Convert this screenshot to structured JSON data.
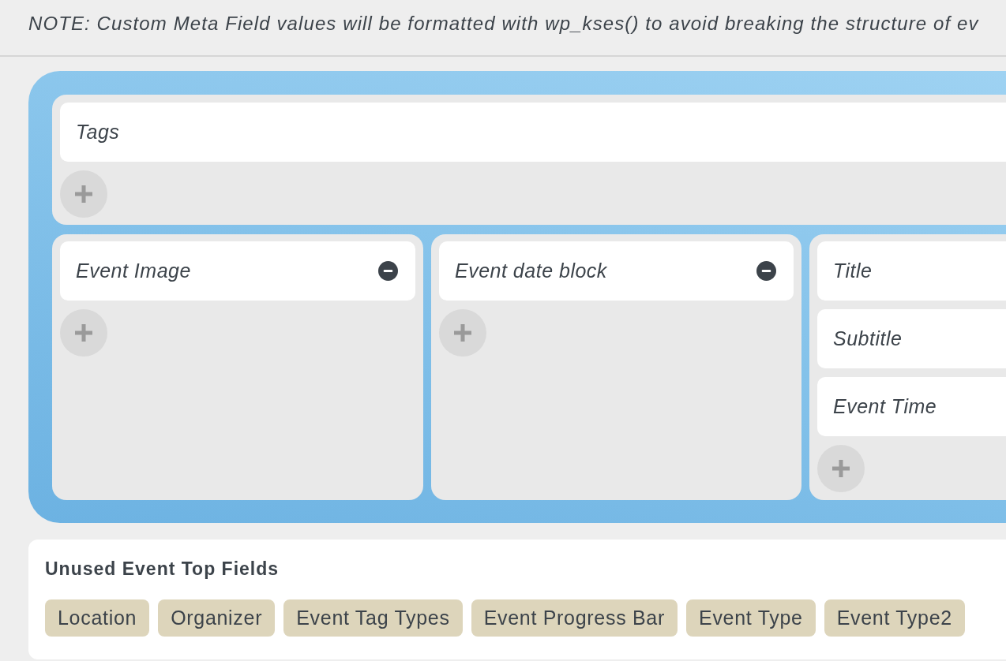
{
  "note": "NOTE: Custom Meta Field values will be formatted with wp_kses() to avoid breaking the structure of ev",
  "layout": {
    "rows": [
      {
        "columns": [
          {
            "fields": [
              {
                "label": "Tags",
                "removable": false
              }
            ]
          }
        ]
      },
      {
        "columns": [
          {
            "fields": [
              {
                "label": "Event Image",
                "removable": true
              }
            ]
          },
          {
            "fields": [
              {
                "label": "Event date block",
                "removable": true
              }
            ]
          },
          {
            "fields": [
              {
                "label": "Title",
                "removable": false
              },
              {
                "label": "Subtitle",
                "removable": false
              },
              {
                "label": "Event Time",
                "removable": false
              }
            ]
          }
        ]
      }
    ]
  },
  "unused_fields": {
    "title": "Unused Event Top Fields",
    "items": [
      "Location",
      "Organizer",
      "Event Tag Types",
      "Event Progress Bar",
      "Event Type",
      "Event Type2"
    ]
  }
}
